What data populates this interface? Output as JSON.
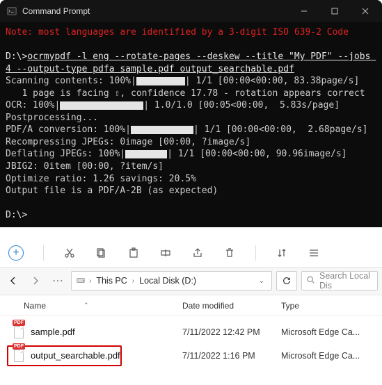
{
  "terminal": {
    "title": "Command Prompt",
    "note": "Note: most languages are identified by a 3-digit ISO 639-2 Code",
    "prompt": "D:\\>",
    "command": "ocrmypdf -l eng --rotate-pages --deskew --title \"My PDF\" --jobs 4 --output-type pdfa sample.pdf output_searchable.pdf",
    "lines": {
      "scan": "Scanning contents: 100%|",
      "scan_tail": "| 1/1 [00:00<00:00, 83.38page/s]",
      "rotate": "   1 page is facing ⇧, confidence 17.78 - rotation appears correct",
      "ocr": "OCR: 100%|",
      "ocr_tail": "| 1.0/1.0 [00:05<00:00,  5.83s/page]",
      "post": "Postprocessing...",
      "pdfa": "PDF/A conversion: 100%|",
      "pdfa_tail": "| 1/1 [00:00<00:00,  2.68page/s]",
      "recomp": "Recompressing JPEGs: 0image [00:00, ?image/s]",
      "deflate": "Deflating JPEGs: 100%|",
      "deflate_tail": "| 1/1 [00:00<00:00, 90.96image/s]",
      "jbig2": "JBIG2: 0item [00:00, ?item/s]",
      "opt": "Optimize ratio: 1.26 savings: 20.5%",
      "out": "Output file is a PDF/A-2B (as expected)",
      "prompt2": "D:\\>"
    }
  },
  "explorer": {
    "breadcrumbs": {
      "a": "This PC",
      "b": "Local Disk (D:)"
    },
    "search_placeholder": "Search Local Dis",
    "headers": {
      "name": "Name",
      "date": "Date modified",
      "type": "Type"
    },
    "files": [
      {
        "name": "sample.pdf",
        "date": "7/11/2022 12:42 PM",
        "type": "Microsoft Edge Ca..."
      },
      {
        "name": "output_searchable.pdf",
        "date": "7/11/2022 1:16 PM",
        "type": "Microsoft Edge Ca..."
      }
    ]
  }
}
